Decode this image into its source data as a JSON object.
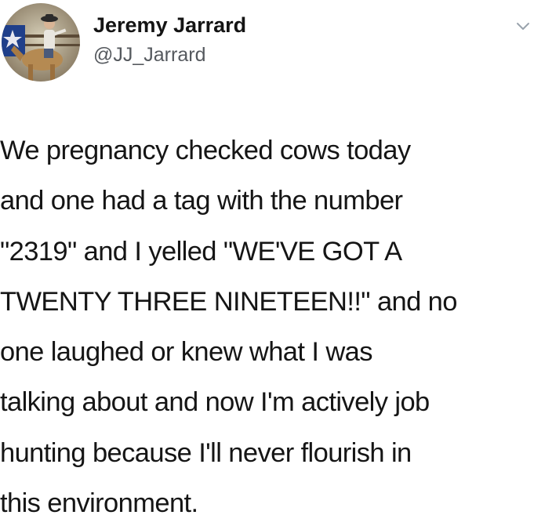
{
  "tweet": {
    "author": {
      "display_name": "Jeremy Jarrard",
      "handle": "@JJ_Jarrard",
      "avatar_icon": "avatar-rodeo-rider-icon"
    },
    "menu_icon": "chevron-down-icon",
    "text_lines": [
      "We pregnancy checked cows today",
      "and one had a tag with the number",
      "\"2319\" and I yelled \"WE'VE GOT A",
      "TWENTY THREE NINETEEN!!\" and no",
      "one laughed or knew what I was",
      "talking about and now I'm actively job",
      "hunting because I'll never flourish in",
      "this environment."
    ]
  },
  "colors": {
    "background": "#ffffff",
    "name": "#141414",
    "handle": "#55595e",
    "body": "#151515",
    "chevron": "#9aa3ad"
  }
}
